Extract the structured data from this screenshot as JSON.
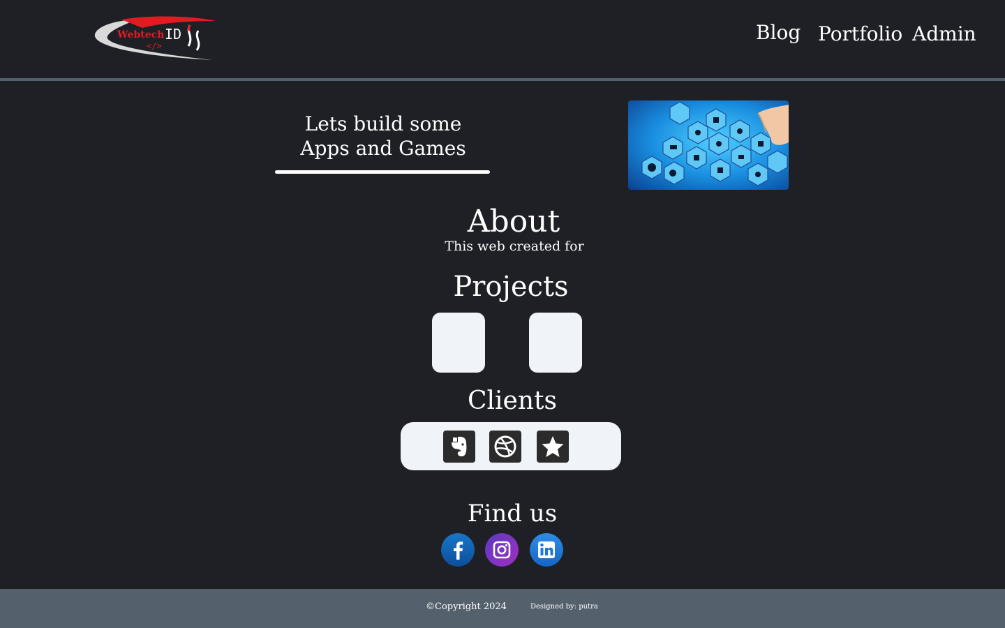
{
  "header": {
    "logo_text": "WebtechIDJs",
    "logo_tag": "</>",
    "nav": {
      "blog": "Blog",
      "portfolio": "Portfolio",
      "admin": "Admin"
    }
  },
  "hero": {
    "line1": "Lets build some",
    "line2": "Apps and Games",
    "image_icon": "tech-hexagon-network-image"
  },
  "about": {
    "title": "About",
    "text": "This web created for"
  },
  "projects": {
    "title": "Projects",
    "items": [
      "project-card",
      "project-card"
    ]
  },
  "clients": {
    "title": "Clients",
    "icons": [
      "evernote-icon",
      "dribbble-icon",
      "star-icon"
    ]
  },
  "find_us": {
    "title": "Find us",
    "icons": [
      "facebook-icon",
      "instagram-icon",
      "linkedin-icon"
    ]
  },
  "footer": {
    "copyright": "©Copyright 2024",
    "designed": "Designed by: putra"
  },
  "colors": {
    "background": "#1f2025",
    "rule": "#54616d",
    "footer": "#54616d",
    "card": "#f0f4f8",
    "logo_red": "#e21b23"
  }
}
